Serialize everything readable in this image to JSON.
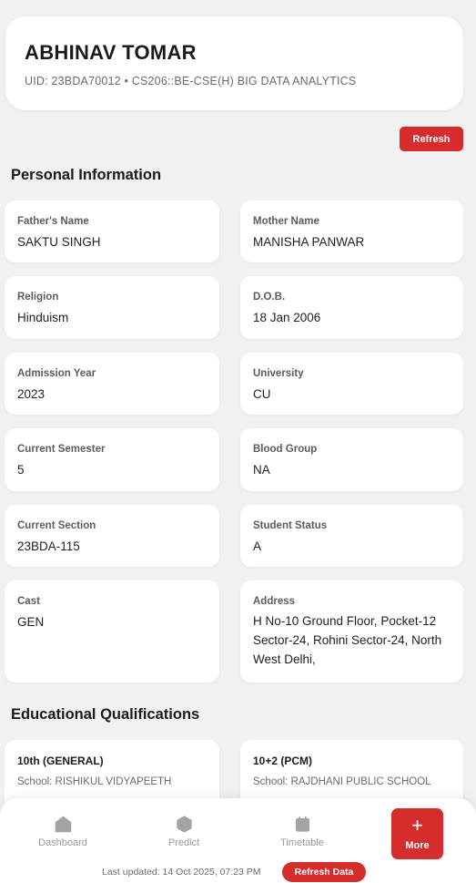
{
  "student": {
    "name": "ABHINAV TOMAR",
    "subtitle": "UID: 23BDA70012 • CS206::BE-CSE(H) BIG DATA ANALYTICS"
  },
  "refresh_label": "Refresh",
  "personal": {
    "title": "Personal Information",
    "fields": [
      {
        "label": "Father's Name",
        "value": "SAKTU SINGH"
      },
      {
        "label": "Mother Name",
        "value": "MANISHA PANWAR"
      },
      {
        "label": "Religion",
        "value": "Hinduism"
      },
      {
        "label": "D.O.B.",
        "value": "18 Jan 2006"
      },
      {
        "label": "Admission Year",
        "value": "2023"
      },
      {
        "label": "University",
        "value": "CU"
      },
      {
        "label": "Current Semester",
        "value": "5"
      },
      {
        "label": "Blood Group",
        "value": "NA"
      },
      {
        "label": "Current Section",
        "value": "23BDA-115"
      },
      {
        "label": "Student Status",
        "value": "A"
      },
      {
        "label": "Cast",
        "value": "GEN"
      },
      {
        "label": "Address",
        "value": "H No-10 Ground Floor, Pocket-12 Sector-24, Rohini Sector-24, North West Delhi,"
      }
    ]
  },
  "education": {
    "title": "Educational Qualifications",
    "items": [
      {
        "title": "10th (GENERAL)",
        "school": "School: RISHIKUL VIDYAPEETH"
      },
      {
        "title": "10+2 (PCM)",
        "school": "School: RAJDHANI PUBLIC SCHOOL"
      }
    ]
  },
  "nav": {
    "items": [
      {
        "label": "Dashboard",
        "icon": "home-icon"
      },
      {
        "label": "Predict",
        "icon": "hexagon-icon"
      },
      {
        "label": "Timetable",
        "icon": "calendar-icon"
      }
    ],
    "more_label": "More",
    "more_icon": "+"
  },
  "footer": {
    "last_updated": "Last updated: 14 Oct 2025, 07:23 PM",
    "refresh_data_label": "Refresh Data"
  },
  "colors": {
    "accent": "#d62c2c",
    "background": "#f1f1f1",
    "card": "#ffffff",
    "nav_icon": "#a3a3a3"
  }
}
